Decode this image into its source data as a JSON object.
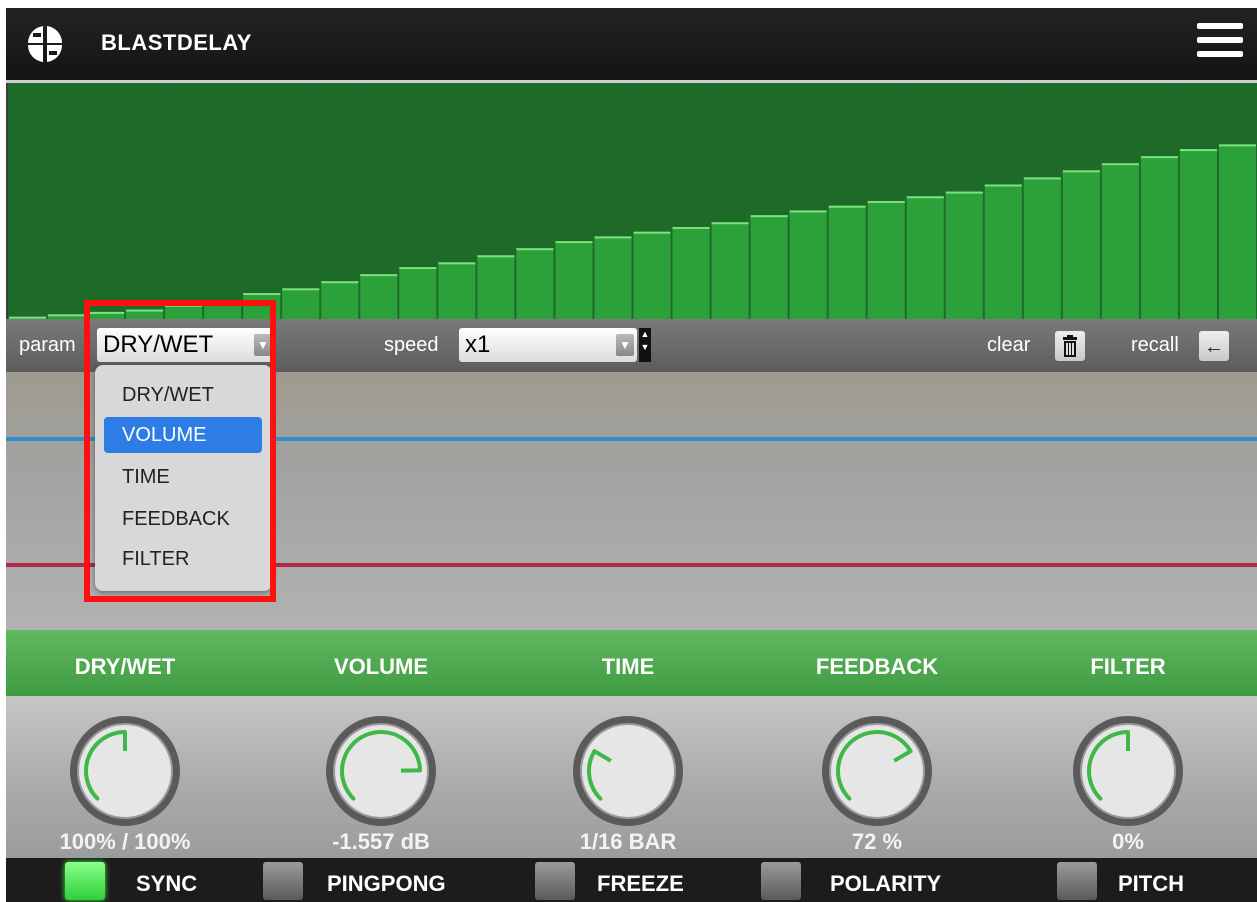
{
  "app": {
    "title": "BLASTDELAY",
    "logo_icon": "blast-logo-icon",
    "menu_icon": "hamburger-menu-icon"
  },
  "step_sequencer": {
    "step_count": 32,
    "levels": [
      0.01,
      0.02,
      0.03,
      0.04,
      0.06,
      0.08,
      0.11,
      0.13,
      0.16,
      0.19,
      0.22,
      0.24,
      0.27,
      0.3,
      0.33,
      0.35,
      0.37,
      0.39,
      0.41,
      0.44,
      0.46,
      0.48,
      0.5,
      0.52,
      0.54,
      0.57,
      0.6,
      0.63,
      0.66,
      0.69,
      0.72,
      0.74
    ],
    "bar_color": "#2ca13a"
  },
  "controls": {
    "param_label": "param",
    "param_value": "DRY/WET",
    "speed_label": "speed",
    "speed_value": "x1",
    "clear_label": "clear",
    "recall_label": "recall",
    "clear_icon": "trash-icon",
    "recall_icon": "arrow-left-icon"
  },
  "dropdown": {
    "options": [
      "DRY/WET",
      "VOLUME",
      "TIME",
      "FEEDBACK",
      "FILTER"
    ],
    "highlighted": "VOLUME"
  },
  "knobs": [
    {
      "label": "DRY/WET",
      "value": "100% / 100%",
      "level": 0.5
    },
    {
      "label": "VOLUME",
      "value": "-1.557 dB",
      "level": 0.83
    },
    {
      "label": "TIME",
      "value": "1/16 BAR",
      "level": 0.28
    },
    {
      "label": "FEEDBACK",
      "value": "72 %",
      "level": 0.72
    },
    {
      "label": "FILTER",
      "value": "0%",
      "level": 0.5
    }
  ],
  "toggles": [
    {
      "label": "SYNC",
      "on": true
    },
    {
      "label": "PINGPONG",
      "on": false
    },
    {
      "label": "FREEZE",
      "on": false
    },
    {
      "label": "POLARITY",
      "on": false
    },
    {
      "label": "PITCH",
      "on": false
    }
  ],
  "colors": {
    "accent_green": "#3fb84a",
    "automation_blue": "#2f8fd0",
    "automation_red": "#b02a4a",
    "dropdown_highlight": "#2e7ce6",
    "annotation_red": "#ff1010"
  }
}
